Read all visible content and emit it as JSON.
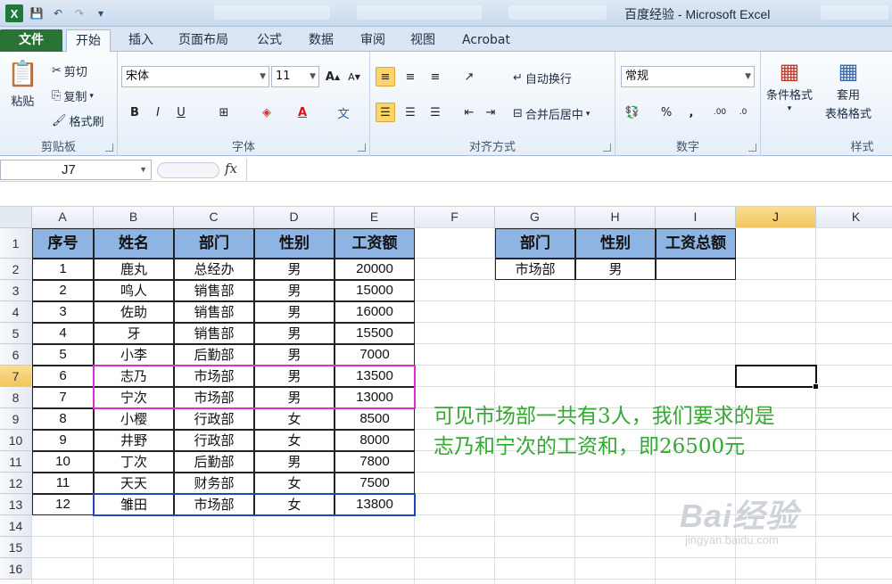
{
  "window": {
    "title": "百度经验 - Microsoft Excel"
  },
  "ribbon_tabs": [
    "文件",
    "开始",
    "插入",
    "页面布局",
    "公式",
    "数据",
    "审阅",
    "视图",
    "Acrobat"
  ],
  "active_tab": "开始",
  "clipboard": {
    "paste": "粘贴",
    "cut": "剪切",
    "copy": "复制",
    "format_painter": "格式刷",
    "label": "剪贴板"
  },
  "font": {
    "name": "宋体",
    "size": "11",
    "label": "字体"
  },
  "alignment": {
    "wrap_text": "自动换行",
    "merge_center": "合并后居中",
    "label": "对齐方式"
  },
  "number": {
    "format": "常规",
    "label": "数字"
  },
  "styles": {
    "conditional": "条件格式",
    "table_format_1": "套用",
    "table_format_2": "表格格式",
    "label": "样式"
  },
  "formula_bar": {
    "name_box": "J7",
    "fx": "fx",
    "formula": ""
  },
  "columns": [
    "A",
    "B",
    "C",
    "D",
    "E",
    "F",
    "G",
    "H",
    "I",
    "J",
    "K"
  ],
  "rows": [
    "1",
    "2",
    "3",
    "4",
    "5",
    "6",
    "7",
    "8",
    "9",
    "10",
    "11",
    "12",
    "13",
    "14",
    "15",
    "16"
  ],
  "active_cell": {
    "column": "J",
    "row": "7"
  },
  "main_table": {
    "headers": [
      "序号",
      "姓名",
      "部门",
      "性别",
      "工资额"
    ],
    "rows": [
      [
        "1",
        "鹿丸",
        "总经办",
        "男",
        "20000"
      ],
      [
        "2",
        "鸣人",
        "销售部",
        "男",
        "15000"
      ],
      [
        "3",
        "佐助",
        "销售部",
        "男",
        "16000"
      ],
      [
        "4",
        "牙",
        "销售部",
        "男",
        "15500"
      ],
      [
        "5",
        "小李",
        "后勤部",
        "男",
        "7000"
      ],
      [
        "6",
        "志乃",
        "市场部",
        "男",
        "13500"
      ],
      [
        "7",
        "宁次",
        "市场部",
        "男",
        "13000"
      ],
      [
        "8",
        "小樱",
        "行政部",
        "女",
        "8500"
      ],
      [
        "9",
        "井野",
        "行政部",
        "女",
        "8000"
      ],
      [
        "10",
        "丁次",
        "后勤部",
        "男",
        "7800"
      ],
      [
        "11",
        "天天",
        "财务部",
        "女",
        "7500"
      ],
      [
        "12",
        "雏田",
        "市场部",
        "女",
        "13800"
      ]
    ]
  },
  "criteria_table": {
    "headers": [
      "部门",
      "性别",
      "工资总额"
    ],
    "row": [
      "市场部",
      "男",
      ""
    ]
  },
  "annotation": {
    "line1": "可见市场部一共有3人，我们要求的是",
    "line2": "志乃和宁次的工资和，即26500元"
  },
  "watermark": {
    "brand": "Bai经验",
    "url": "jingyan.baidu.com"
  },
  "colors": {
    "header_fill": "#8db4e2",
    "highlight_pink": "#e02bd2",
    "highlight_blue": "#2346b8",
    "annotation_green": "#35a832",
    "file_tab": "#2a7337"
  }
}
